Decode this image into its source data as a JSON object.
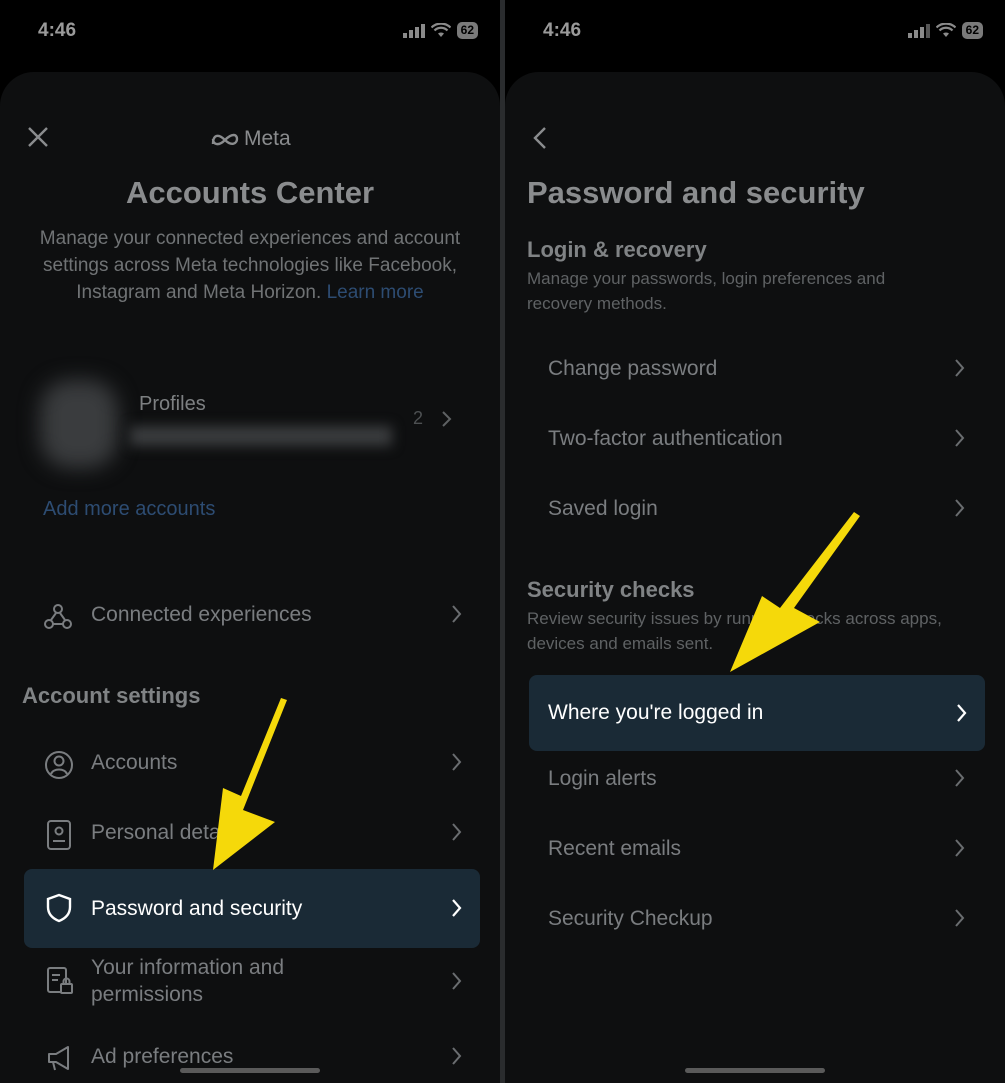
{
  "status": {
    "time": "4:46",
    "battery": "62"
  },
  "left": {
    "brand": "Meta",
    "title": "Accounts Center",
    "description": "Manage your connected experiences and account settings across Meta technologies like Facebook, Instagram and Meta Horizon.",
    "learn_more": "Learn more",
    "profiles_label": "Profiles",
    "profiles_count": "2",
    "add_accounts": "Add more accounts",
    "connected": "Connected experiences",
    "account_settings_heading": "Account settings",
    "items": [
      {
        "label": "Accounts",
        "icon": "user-circle-icon"
      },
      {
        "label": "Personal details",
        "icon": "id-card-icon"
      },
      {
        "label": "Password and security",
        "icon": "shield-icon",
        "highlighted": true
      },
      {
        "label": "Your information and permissions",
        "icon": "info-lock-icon"
      },
      {
        "label": "Ad preferences",
        "icon": "megaphone-icon"
      }
    ]
  },
  "right": {
    "title": "Password and security",
    "login_heading": "Login & recovery",
    "login_desc": "Manage your passwords, login preferences and recovery methods.",
    "login_items": [
      "Change password",
      "Two-factor authentication",
      "Saved login"
    ],
    "security_heading": "Security checks",
    "security_desc": "Review security issues by running checks across apps, devices and emails sent.",
    "security_items": [
      {
        "label": "Where you're logged in",
        "highlighted": true
      },
      {
        "label": "Login alerts"
      },
      {
        "label": "Recent emails"
      },
      {
        "label": "Security Checkup"
      }
    ]
  },
  "colors": {
    "arrow": "#f5d90a",
    "highlight": "#1a2a36"
  }
}
